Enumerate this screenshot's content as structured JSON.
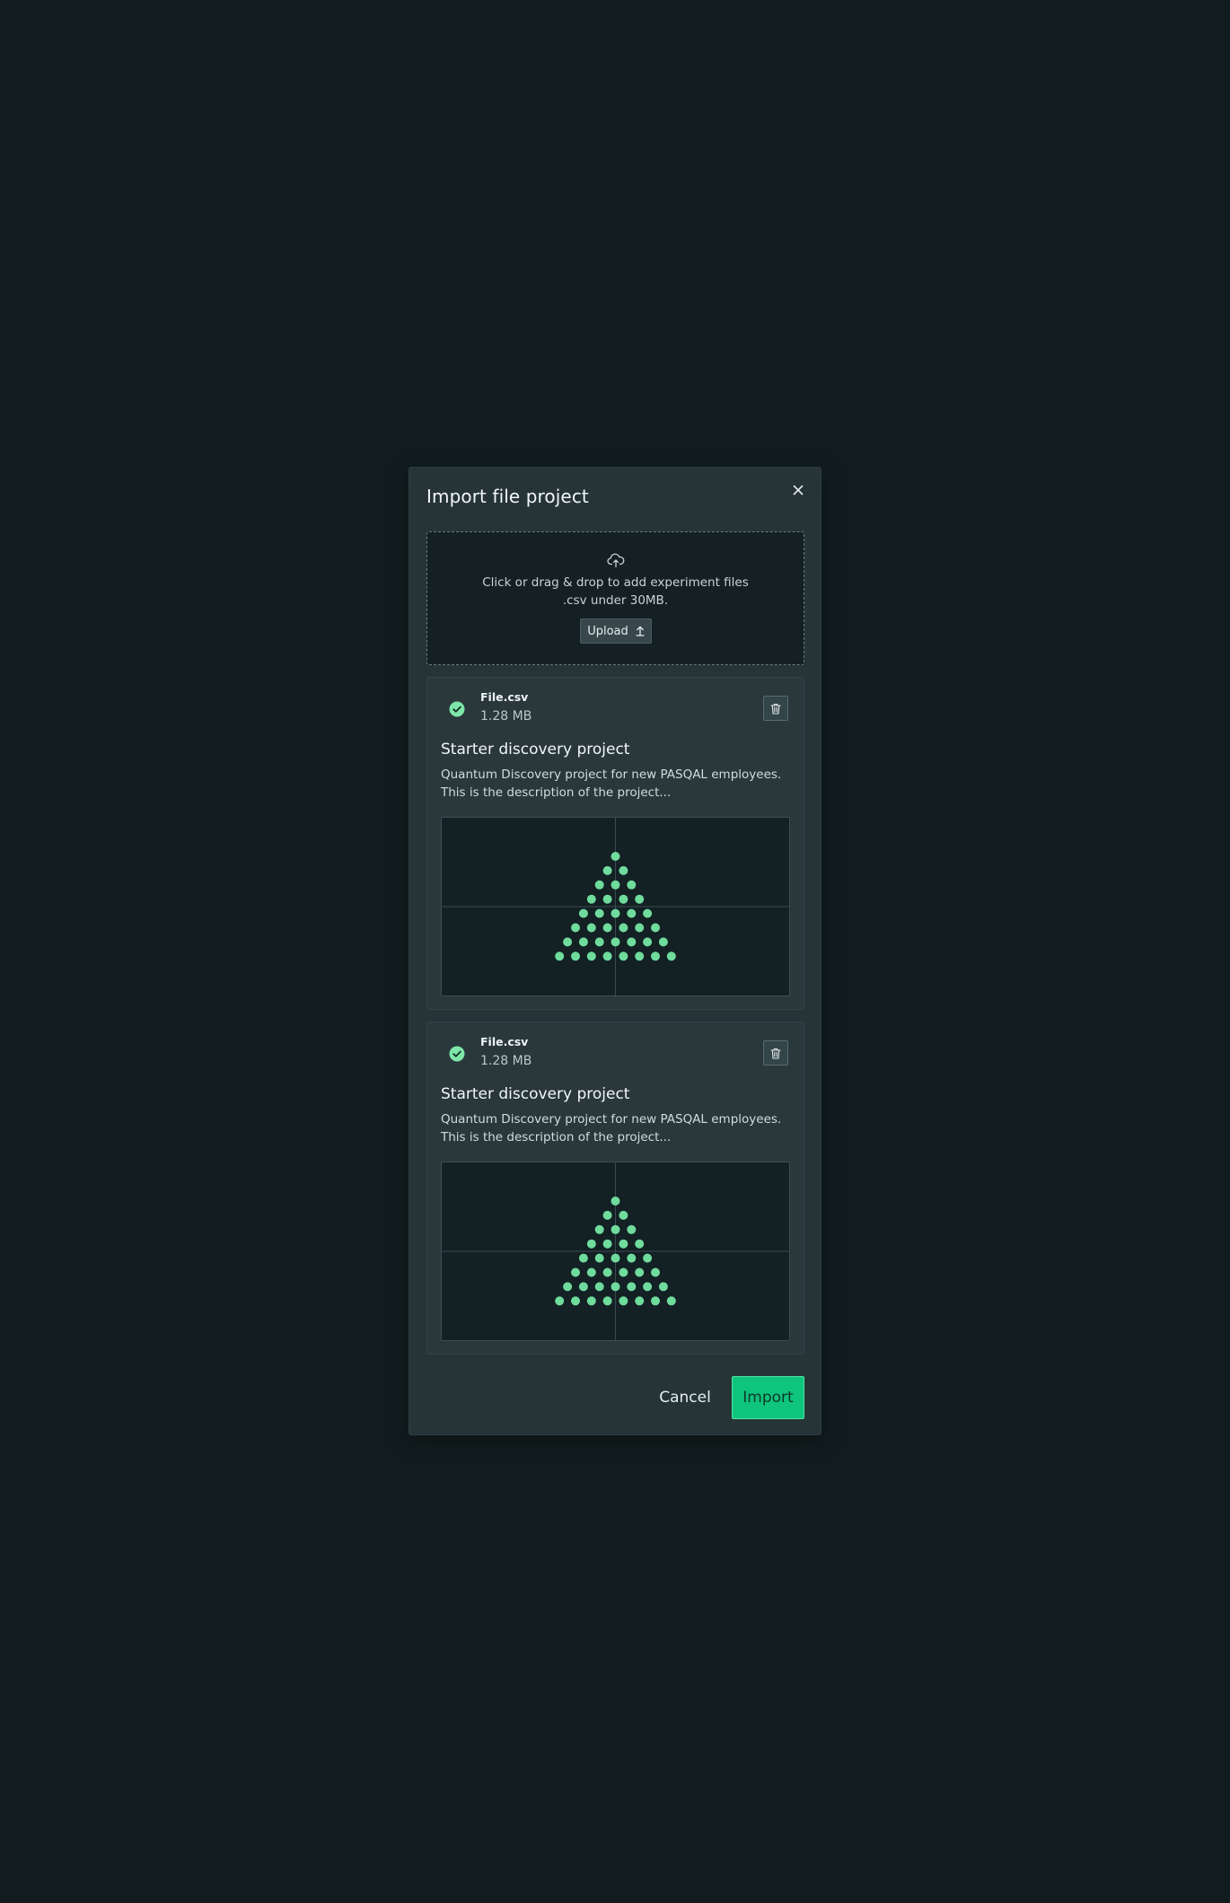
{
  "modal": {
    "title": "Import file project",
    "close_icon": "close-icon"
  },
  "dropzone": {
    "icon": "cloud-upload-icon",
    "line1": "Click or drag & drop to add experiment files",
    "line2": ".csv under 30MB.",
    "upload_label": "Upload",
    "upload_icon": "arrow-up-icon"
  },
  "files": [
    {
      "status_icon": "check-circle-icon",
      "name": "File.csv",
      "size": "1.28 MB",
      "delete_icon": "trash-icon",
      "project_title": "Starter discovery project",
      "project_description": "Quantum Discovery project for new PASQAL employees. This is the description of the project...",
      "register_rows": 8
    },
    {
      "status_icon": "check-circle-icon",
      "name": "File.csv",
      "size": "1.28 MB",
      "delete_icon": "trash-icon",
      "project_title": "Starter discovery project",
      "project_description": "Quantum Discovery project for new PASQAL employees. This is the description of the project...",
      "register_rows": 8
    }
  ],
  "footer": {
    "cancel_label": "Cancel",
    "import_label": "Import"
  },
  "colors": {
    "background": "#121c1e",
    "modal": "#263438",
    "accent": "#0fc47c",
    "atom": "#6fdb9c",
    "check": "#7ee6a8"
  }
}
